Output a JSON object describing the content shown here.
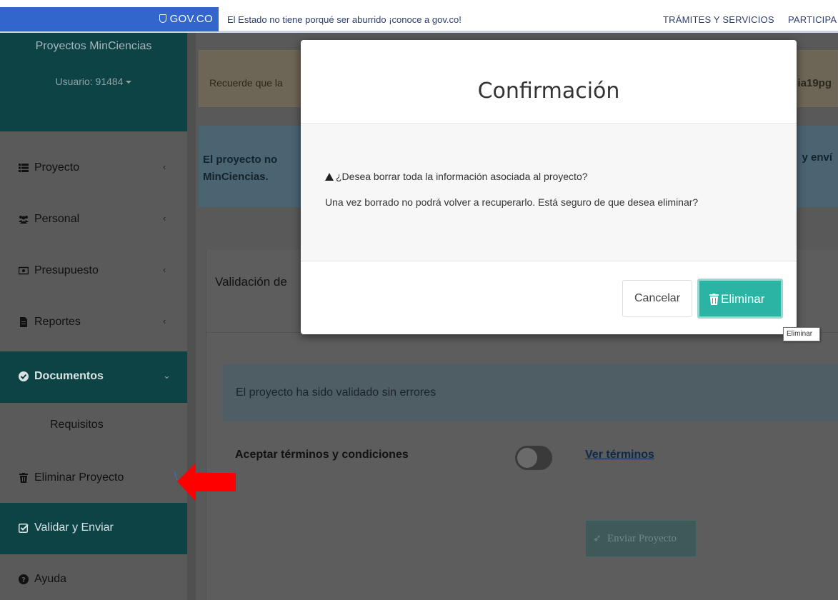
{
  "govbar": {
    "logo": "GOV.CO",
    "message": "El Estado no tiene porqué ser aburrido ¡conoce a gov.co!",
    "link_tramites": "TRÁMITES Y SERVICIOS",
    "link_participa": "PARTICIPA"
  },
  "sidebar": {
    "title": "Proyectos MinCiencias",
    "user": "Usuario: 91484",
    "items": [
      {
        "label": "Proyecto",
        "icon": "list-icon"
      },
      {
        "label": "Personal",
        "icon": "users-icon"
      },
      {
        "label": "Presupuesto",
        "icon": "money-icon"
      },
      {
        "label": "Reportes",
        "icon": "file-icon"
      },
      {
        "label": "Documentos",
        "icon": "check-circle-icon"
      },
      {
        "label": "Requisitos"
      },
      {
        "label": "Eliminar Proyecto",
        "icon": "trash-icon"
      },
      {
        "label": "Validar y Enviar",
        "icon": "check-square-icon"
      },
      {
        "label": "Ayuda",
        "icon": "question-circle-icon"
      }
    ]
  },
  "main": {
    "alert_warn_left": "Recuerde que la",
    "alert_warn_right": "ia19pg",
    "alert_info_line1": "El proyecto no",
    "alert_info_line2": "MinCiencias.",
    "alert_info_right": "y enví",
    "panel_title": "Validación de",
    "validated_msg": "El proyecto ha sido validado sin errores",
    "terms_label": "Aceptar términos y condiciones",
    "terms_link": "Ver términos",
    "send_button": "Enviar Proyecto"
  },
  "modal": {
    "title": "Confirmación",
    "question": "¿Desea borrar toda la información asociada al proyecto?",
    "note": "Una vez borrado no podrá volver a recuperarlo. Está seguro de que desea eliminar?",
    "cancel": "Cancelar",
    "delete": "Eliminar",
    "tooltip": "Eliminar"
  },
  "colors": {
    "accent": "#2bb3a3",
    "sidebar_dark": "#0e4346",
    "gov_blue": "#3366cc",
    "arrow": "#ff0000"
  }
}
